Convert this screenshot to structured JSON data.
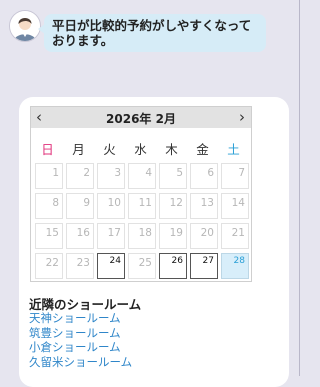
{
  "bubble": {
    "text": "平日が比較的予約がしやすくなっております。"
  },
  "calendar": {
    "month_label": "2026年 2月",
    "prev_label": "‹",
    "next_label": "›",
    "weekdays": [
      "日",
      "月",
      "火",
      "水",
      "木",
      "金",
      "土"
    ],
    "weeks": [
      [
        "1",
        "2",
        "3",
        "4",
        "5",
        "6",
        "7"
      ],
      [
        "8",
        "9",
        "10",
        "11",
        "12",
        "13",
        "14"
      ],
      [
        "15",
        "16",
        "17",
        "18",
        "19",
        "20",
        "21"
      ],
      [
        "22",
        "23",
        "24",
        "25",
        "26",
        "27",
        "28"
      ]
    ],
    "available_days": [
      "24",
      "26",
      "27",
      "28"
    ],
    "selected_day": "28"
  },
  "nearby": {
    "title": "近隣のショールーム",
    "showrooms": [
      "天神ショールーム",
      "筑豊ショールーム",
      "小倉ショールーム",
      "久留米ショールーム"
    ]
  },
  "colors": {
    "sunday": "#e0307a",
    "saturday": "#2a9fd6",
    "link": "#2f86c9",
    "bubble": "#d6ecf7"
  }
}
